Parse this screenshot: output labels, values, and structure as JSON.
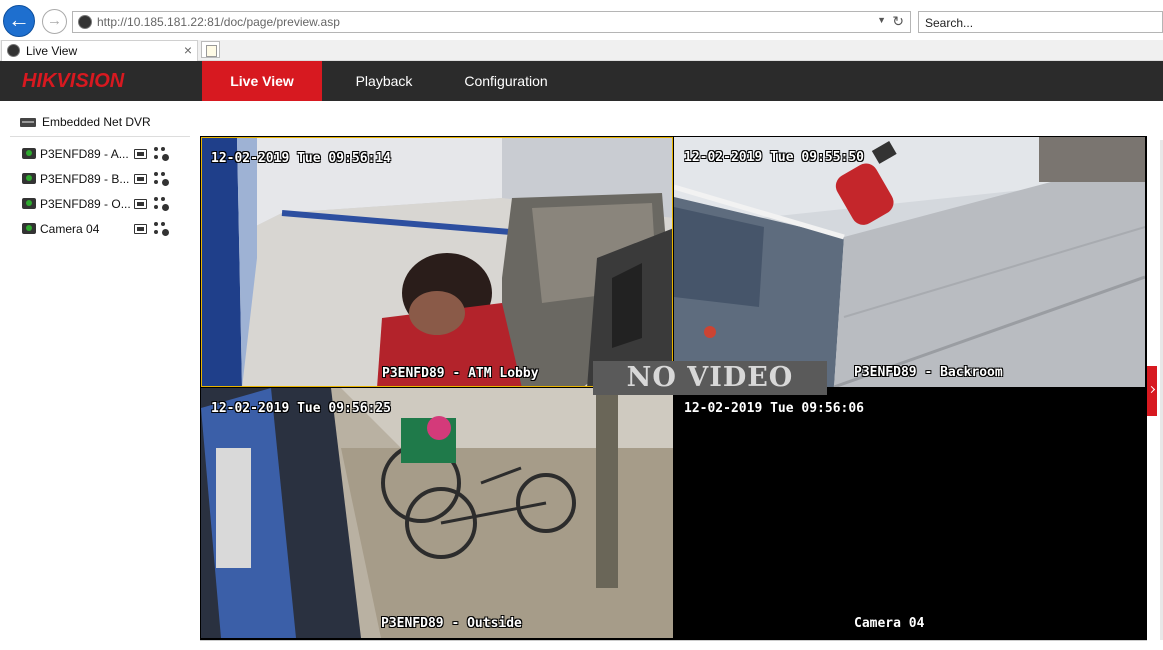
{
  "browser": {
    "url_host": "http://10.185.181.22",
    "url_rest": ":81/doc/page/preview.asp",
    "search_placeholder": "Search...",
    "tab_title": "Live View",
    "tab_close": "×"
  },
  "app": {
    "logo_hik": "HIK",
    "logo_vision": "VISION",
    "nav": [
      {
        "label": "Live View",
        "active": true
      },
      {
        "label": "Playback",
        "active": false
      },
      {
        "label": "Configuration",
        "active": false
      }
    ]
  },
  "sidebar": {
    "device": "Embedded Net DVR",
    "cameras": [
      {
        "label": "P3ENFD89 - A..."
      },
      {
        "label": "P3ENFD89 - B..."
      },
      {
        "label": "P3ENFD89 - O..."
      },
      {
        "label": "Camera 04"
      }
    ]
  },
  "tiles": [
    {
      "timestamp": "12-02-2019 Tue 09:56:14",
      "name": "P3ENFD89 - ATM Lobby"
    },
    {
      "timestamp": "12-02-2019 Tue 09:55:50",
      "name": "P3ENFD89 - Backroom"
    },
    {
      "timestamp": "12-02-2019 Tue 09:56:25",
      "name": "P3ENFD89 - Outside"
    },
    {
      "timestamp": "12-02-2019 Tue 09:56:06",
      "name": "Camera 04",
      "overlay": "NO VIDEO"
    }
  ]
}
